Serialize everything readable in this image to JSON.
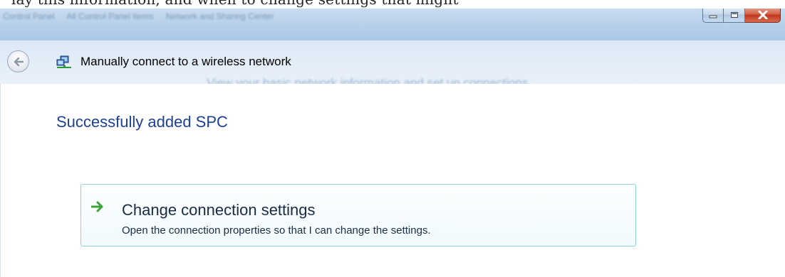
{
  "window": {
    "background_caption": "lay this information, and when to change settings that might",
    "breadcrumbs": [
      "Control Panel",
      "All Control Panel Items",
      "Network and Sharing Center"
    ],
    "controls": {
      "minimize_icon": "minimize-icon",
      "maximize_icon": "maximize-icon",
      "close_icon": "close-icon"
    }
  },
  "nav": {
    "back_icon": "back-arrow-icon",
    "wireless_icon": "wireless-network-icon",
    "title": "Manually connect to a wireless network",
    "background_ghost": "View your basic network information and set up connections"
  },
  "main": {
    "heading": "Successfully added SPC",
    "command": {
      "icon": "green-arrow-icon",
      "title": "Change connection settings",
      "description": "Open the connection properties so that I can change the settings."
    }
  },
  "colors": {
    "heading": "#1d3f99",
    "command_border": "#8fd0e6",
    "arrow": "#3aa33a",
    "close_button": "#c0391c"
  }
}
